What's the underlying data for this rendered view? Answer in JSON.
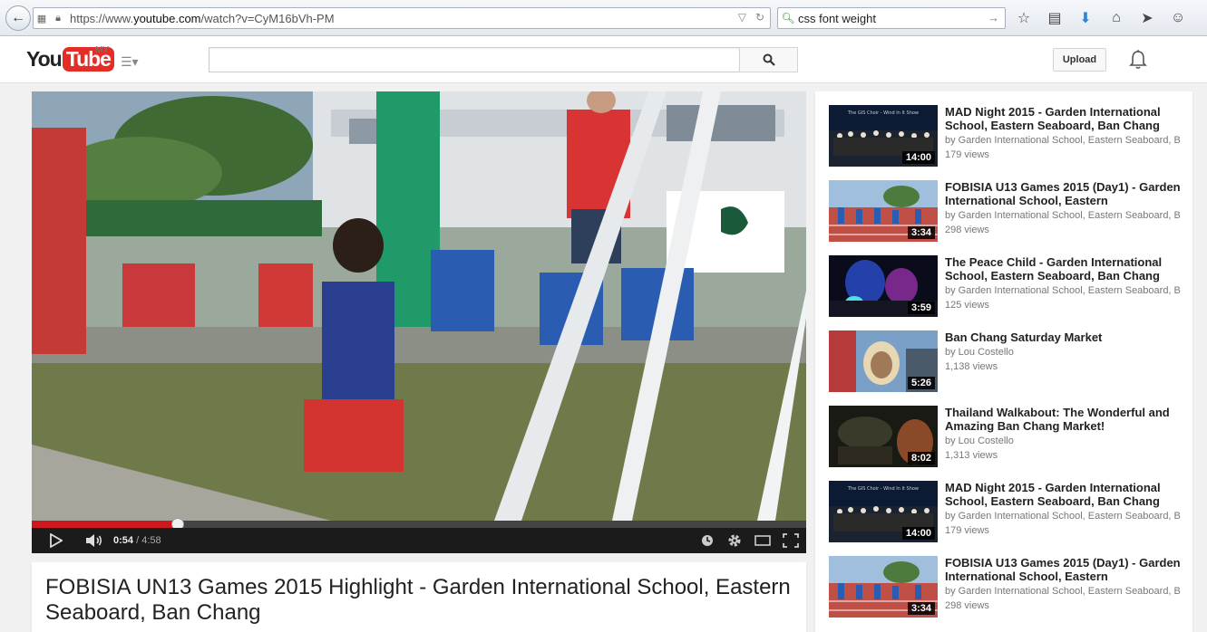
{
  "browser": {
    "url_prefix": "https://www.",
    "url_domain": "youtube.com",
    "url_path": "/watch?v=CyM16bVh-PM",
    "search_query": "css font weight"
  },
  "masthead": {
    "logo_you": "You",
    "logo_tube": "Tube",
    "country": "MY",
    "search_value": "",
    "upload_label": "Upload"
  },
  "player": {
    "current_time": "0:54",
    "separator": " / ",
    "duration": "4:58",
    "progress_fraction": 0.1886
  },
  "video": {
    "title": "FOBISIA UN13 Games 2015 Highlight - Garden International School, Eastern Seaboard, Ban Chang"
  },
  "sidebar": {
    "items": [
      {
        "title": "MAD Night 2015 - Garden International School, Eastern Seaboard, Ban Chang",
        "channel": "by Garden International School, Eastern Seaboard, Ba",
        "views": "179 views",
        "duration": "14:00",
        "thumb": "stage-choir"
      },
      {
        "title": "FOBISIA U13 Games 2015 (Day1) - Garden International School, Eastern",
        "channel": "by Garden International School, Eastern Seaboard, Ba",
        "views": "298 views",
        "duration": "3:34",
        "thumb": "track"
      },
      {
        "title": "The Peace Child - Garden International School, Eastern Seaboard, Ban Chang",
        "channel": "by Garden International School, Eastern Seaboard, Ba",
        "views": "125 views",
        "duration": "3:59",
        "thumb": "stage-lights"
      },
      {
        "title": "Ban Chang Saturday Market",
        "channel": "by Lou Costello",
        "views": "1,138 views",
        "duration": "5:26",
        "thumb": "market-face"
      },
      {
        "title": "Thailand Walkabout: The Wonderful and Amazing Ban Chang Market!",
        "channel": "by Lou Costello",
        "views": "1,313 views",
        "duration": "8:02",
        "thumb": "market-dark"
      },
      {
        "title": "MAD Night 2015 - Garden International School, Eastern Seaboard, Ban Chang",
        "channel": "by Garden International School, Eastern Seaboard, Ba",
        "views": "179 views",
        "duration": "14:00",
        "thumb": "stage-choir"
      },
      {
        "title": "FOBISIA U13 Games 2015 (Day1) - Garden International School, Eastern",
        "channel": "by Garden International School, Eastern Seaboard, Ba",
        "views": "298 views",
        "duration": "3:34",
        "thumb": "track"
      }
    ]
  }
}
